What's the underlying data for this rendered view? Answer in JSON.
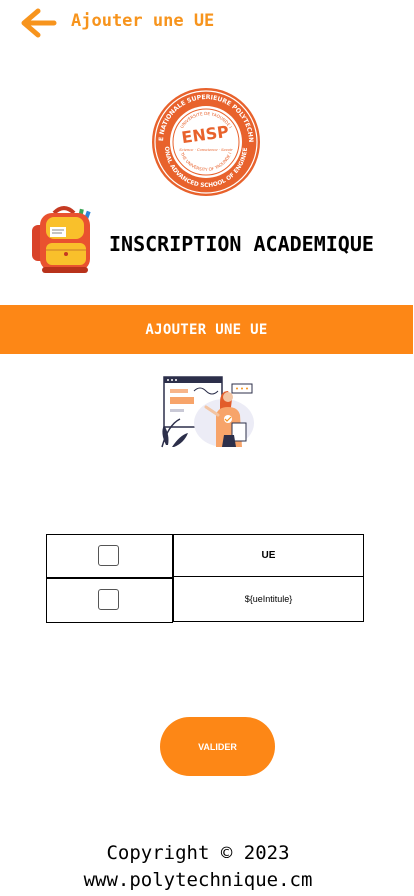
{
  "header": {
    "back_icon": "arrow-left-icon",
    "title": "Ajouter une UE"
  },
  "brand": {
    "logo_text": "ENSP",
    "logo_ring_top": "ECOLE NATIONALE SUPERIEURE POLYTECHNIQUE",
    "logo_ring_bottom": "NATIONAL ADVANCED SCHOOL OF ENGINEERING",
    "logo_inner_top": "UNIVERSITE DE YAOUNDE I",
    "logo_inner_bottom": "THE UNIVERSITY OF YAOUNDE I",
    "logo_motto": "Science · Conscience · Savoir"
  },
  "app": {
    "title": "INSCRIPTION ACADEMIQUE"
  },
  "section": {
    "label": "AJOUTER UNE UE"
  },
  "table": {
    "header": "UE",
    "rows": [
      {
        "label": "${ueIntitule}",
        "checked": false
      }
    ]
  },
  "actions": {
    "validate_label": "VALIDER"
  },
  "footer": {
    "copyright": "Copyright © 2023",
    "website": "www.polytechnique.cm"
  },
  "colors": {
    "accent": "#fd8716",
    "accent_text": "#f7941d",
    "text": "#000000",
    "background": "#ffffff"
  }
}
